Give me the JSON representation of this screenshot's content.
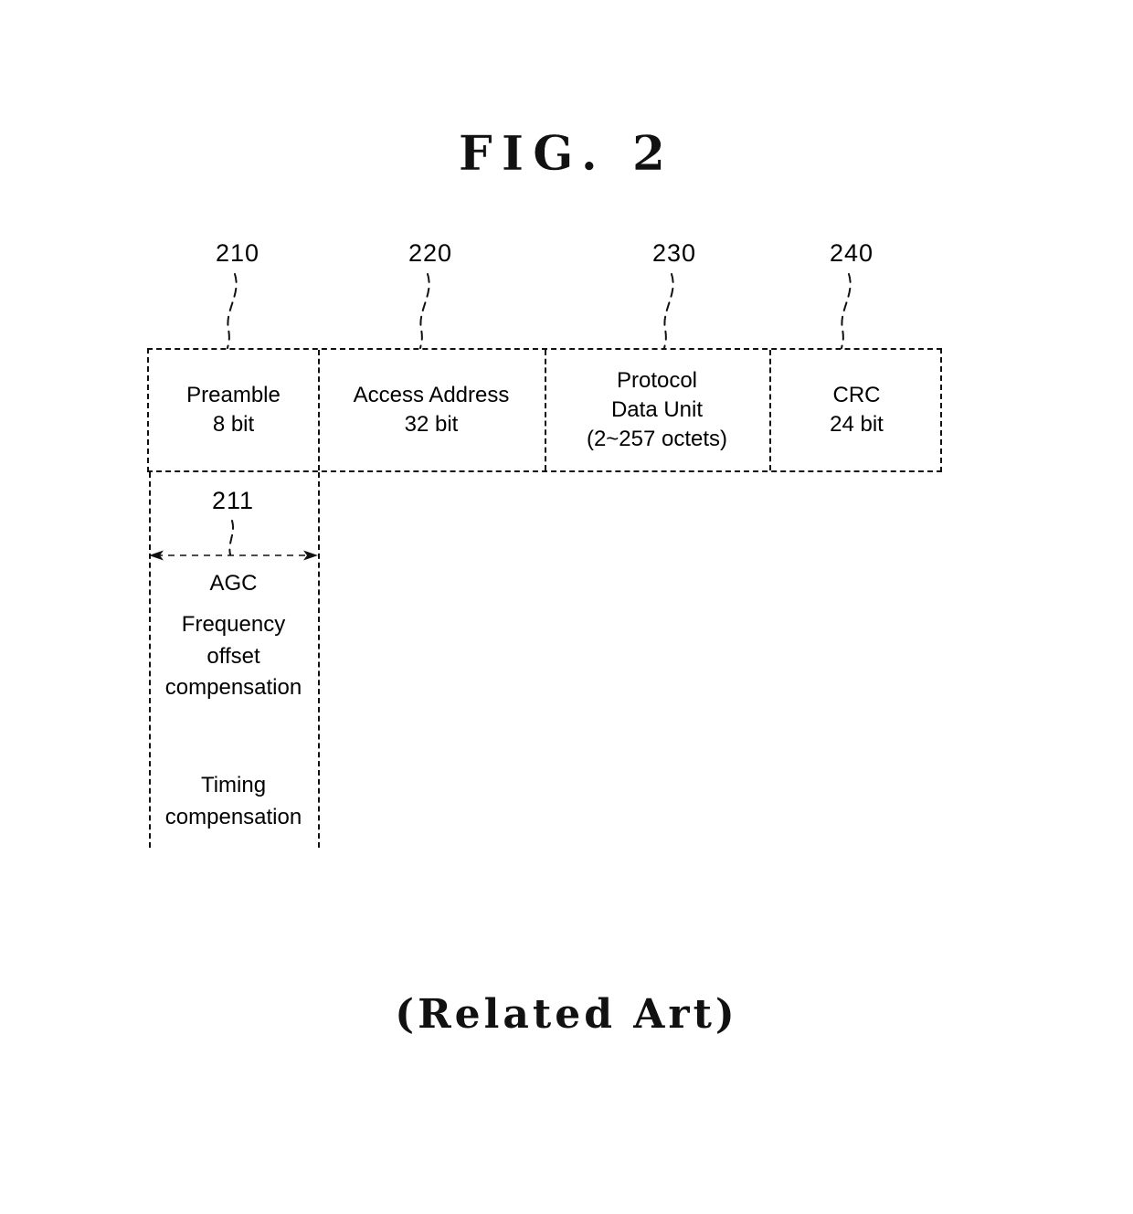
{
  "figure": {
    "title": "FIG.  2",
    "caption": "(Related Art)"
  },
  "reference_numerals": [
    {
      "id": "210",
      "label": "210",
      "target": "preamble"
    },
    {
      "id": "220",
      "label": "220",
      "target": "access-address"
    },
    {
      "id": "230",
      "label": "230",
      "target": "protocol-data-unit"
    },
    {
      "id": "240",
      "label": "240",
      "target": "crc"
    },
    {
      "id": "211",
      "label": "211",
      "target": "preamble-detail"
    }
  ],
  "packet": {
    "fields": [
      {
        "name": "preamble",
        "line1": "Preamble",
        "line2": "8 bit",
        "line3": ""
      },
      {
        "name": "access-address",
        "line1": "Access Address",
        "line2": "32 bit",
        "line3": ""
      },
      {
        "name": "protocol-data-unit",
        "line1": "Protocol",
        "line2": "Data Unit",
        "line3": "(2~257 octets)"
      },
      {
        "name": "crc",
        "line1": "CRC",
        "line2": "24 bit",
        "line3": ""
      }
    ]
  },
  "preamble_detail": {
    "agc": "AGC",
    "frequency_line1": "Frequency",
    "frequency_line2": "offset",
    "frequency_line3": "compensation",
    "timing_line1": "Timing",
    "timing_line2": "compensation"
  },
  "colors": {
    "ink": "#000000",
    "line": "#111111",
    "background": "#ffffff"
  }
}
